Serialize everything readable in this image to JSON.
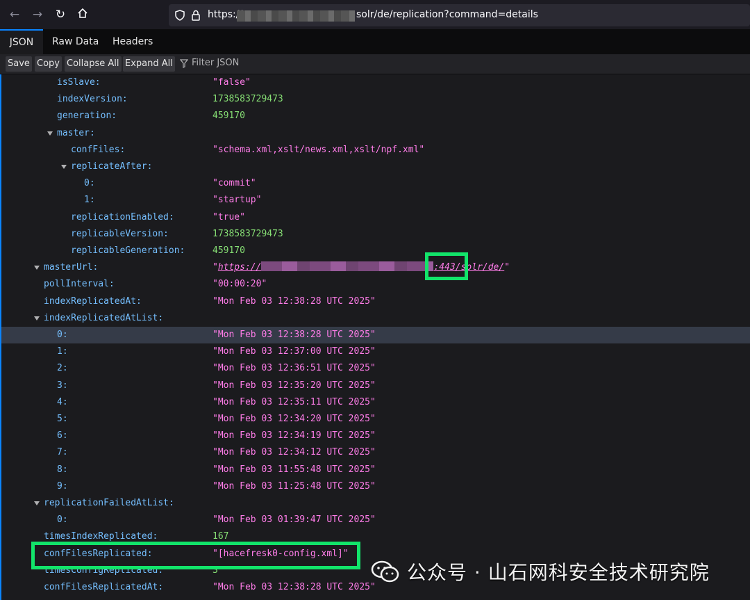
{
  "browser": {
    "url_prefix": "https://",
    "url_suffix": "solr/de/replication?command=details",
    "icons": [
      "back-arrow-icon",
      "forward-arrow-icon",
      "reload-icon",
      "home-icon",
      "shield-icon",
      "lock-icon"
    ]
  },
  "tabs": [
    {
      "label": "JSON",
      "active": true
    },
    {
      "label": "Raw Data",
      "active": false
    },
    {
      "label": "Headers",
      "active": false
    }
  ],
  "toolbar": {
    "save": "Save",
    "copy": "Copy",
    "collapse_all": "Collapse All",
    "expand_all": "Expand All",
    "filter_placeholder": "Filter JSON"
  },
  "rows": [
    {
      "key": "isSlave:",
      "value": "\"false\"",
      "type": "str"
    },
    {
      "key": "indexVersion:",
      "value": "1738583729473",
      "type": "num"
    },
    {
      "key": "generation:",
      "value": "459170",
      "type": "num"
    },
    {
      "key": "master:",
      "value": "",
      "type": "obj"
    },
    {
      "key": "confFiles:",
      "value": "\"schema.xml,xslt/news.xml,xslt/npf.xml\"",
      "type": "str"
    },
    {
      "key": "replicateAfter:",
      "value": "",
      "type": "obj"
    },
    {
      "key": "0:",
      "value": "\"commit\"",
      "type": "str"
    },
    {
      "key": "1:",
      "value": "\"startup\"",
      "type": "str"
    },
    {
      "key": "replicationEnabled:",
      "value": "\"true\"",
      "type": "str"
    },
    {
      "key": "replicableVersion:",
      "value": "1738583729473",
      "type": "num"
    },
    {
      "key": "replicableGeneration:",
      "value": "459170",
      "type": "num"
    },
    {
      "key": "masterUrl:",
      "value_pre": "https://",
      "value_port": ":443/",
      "value_post": "solr/de/",
      "type": "url"
    },
    {
      "key": "pollInterval:",
      "value": "\"00:00:20\"",
      "type": "str"
    },
    {
      "key": "indexReplicatedAt:",
      "value": "\"Mon Feb 03 12:38:28 UTC 2025\"",
      "type": "str"
    },
    {
      "key": "indexReplicatedAtList:",
      "value": "",
      "type": "obj"
    },
    {
      "key": "0:",
      "value": "\"Mon Feb 03 12:38:28 UTC 2025\"",
      "type": "str"
    },
    {
      "key": "1:",
      "value": "\"Mon Feb 03 12:37:00 UTC 2025\"",
      "type": "str"
    },
    {
      "key": "2:",
      "value": "\"Mon Feb 03 12:36:51 UTC 2025\"",
      "type": "str"
    },
    {
      "key": "3:",
      "value": "\"Mon Feb 03 12:35:20 UTC 2025\"",
      "type": "str"
    },
    {
      "key": "4:",
      "value": "\"Mon Feb 03 12:35:11 UTC 2025\"",
      "type": "str"
    },
    {
      "key": "5:",
      "value": "\"Mon Feb 03 12:34:20 UTC 2025\"",
      "type": "str"
    },
    {
      "key": "6:",
      "value": "\"Mon Feb 03 12:34:19 UTC 2025\"",
      "type": "str"
    },
    {
      "key": "7:",
      "value": "\"Mon Feb 03 12:34:12 UTC 2025\"",
      "type": "str"
    },
    {
      "key": "8:",
      "value": "\"Mon Feb 03 11:55:48 UTC 2025\"",
      "type": "str"
    },
    {
      "key": "9:",
      "value": "\"Mon Feb 03 11:25:48 UTC 2025\"",
      "type": "str"
    },
    {
      "key": "replicationFailedAtList:",
      "value": "",
      "type": "obj"
    },
    {
      "key": "0:",
      "value": "\"Mon Feb 03 01:39:47 UTC 2025\"",
      "type": "str"
    },
    {
      "key": "timesIndexReplicated:",
      "value": "167",
      "type": "num"
    },
    {
      "key": "confFilesReplicated:",
      "value": "\"[hacefresk0-config.xml]\"",
      "type": "str"
    },
    {
      "key": "timesConfigReplicated:",
      "value": "3",
      "type": "num"
    },
    {
      "key": "confFilesReplicatedAt:",
      "value": "\"Mon Feb 03 12:38:28 UTC 2025\"",
      "type": "str"
    }
  ],
  "watermark": {
    "text": "公众号 · 山石网科安全技术研究院",
    "icon": "wechat-logo-icon"
  },
  "colors": {
    "key": "#75bfff",
    "string": "#ff7de9",
    "number": "#86de74",
    "highlight_box": "#12e46a",
    "tab_accent": "#0a84ff"
  }
}
